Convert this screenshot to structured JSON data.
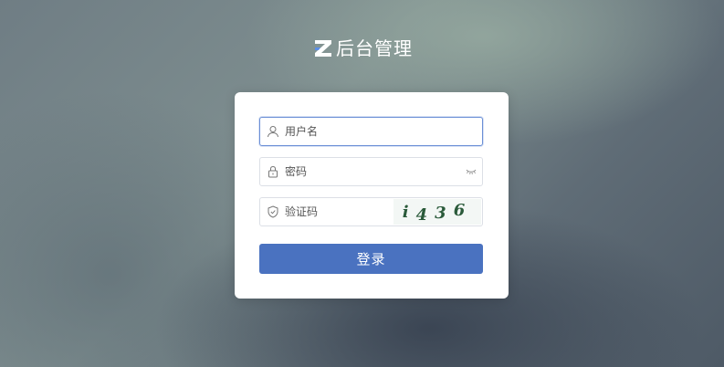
{
  "brand": {
    "title": "后台管理",
    "logo_icon": "z-logo-icon"
  },
  "login_form": {
    "username": {
      "placeholder": "用户名",
      "value": "",
      "icon": "user-icon"
    },
    "password": {
      "placeholder": "密码",
      "value": "",
      "icon": "lock-icon",
      "toggle_icon": "eye-closed-icon"
    },
    "captcha": {
      "placeholder": "验证码",
      "value": "",
      "icon": "shield-icon",
      "image_chars": [
        "i",
        "4",
        "3",
        "6"
      ]
    },
    "submit_label": "登录"
  },
  "colors": {
    "accent": "#4a72c0",
    "captcha_text": "#2a5a3a",
    "active_border": "#6b8fd6"
  }
}
